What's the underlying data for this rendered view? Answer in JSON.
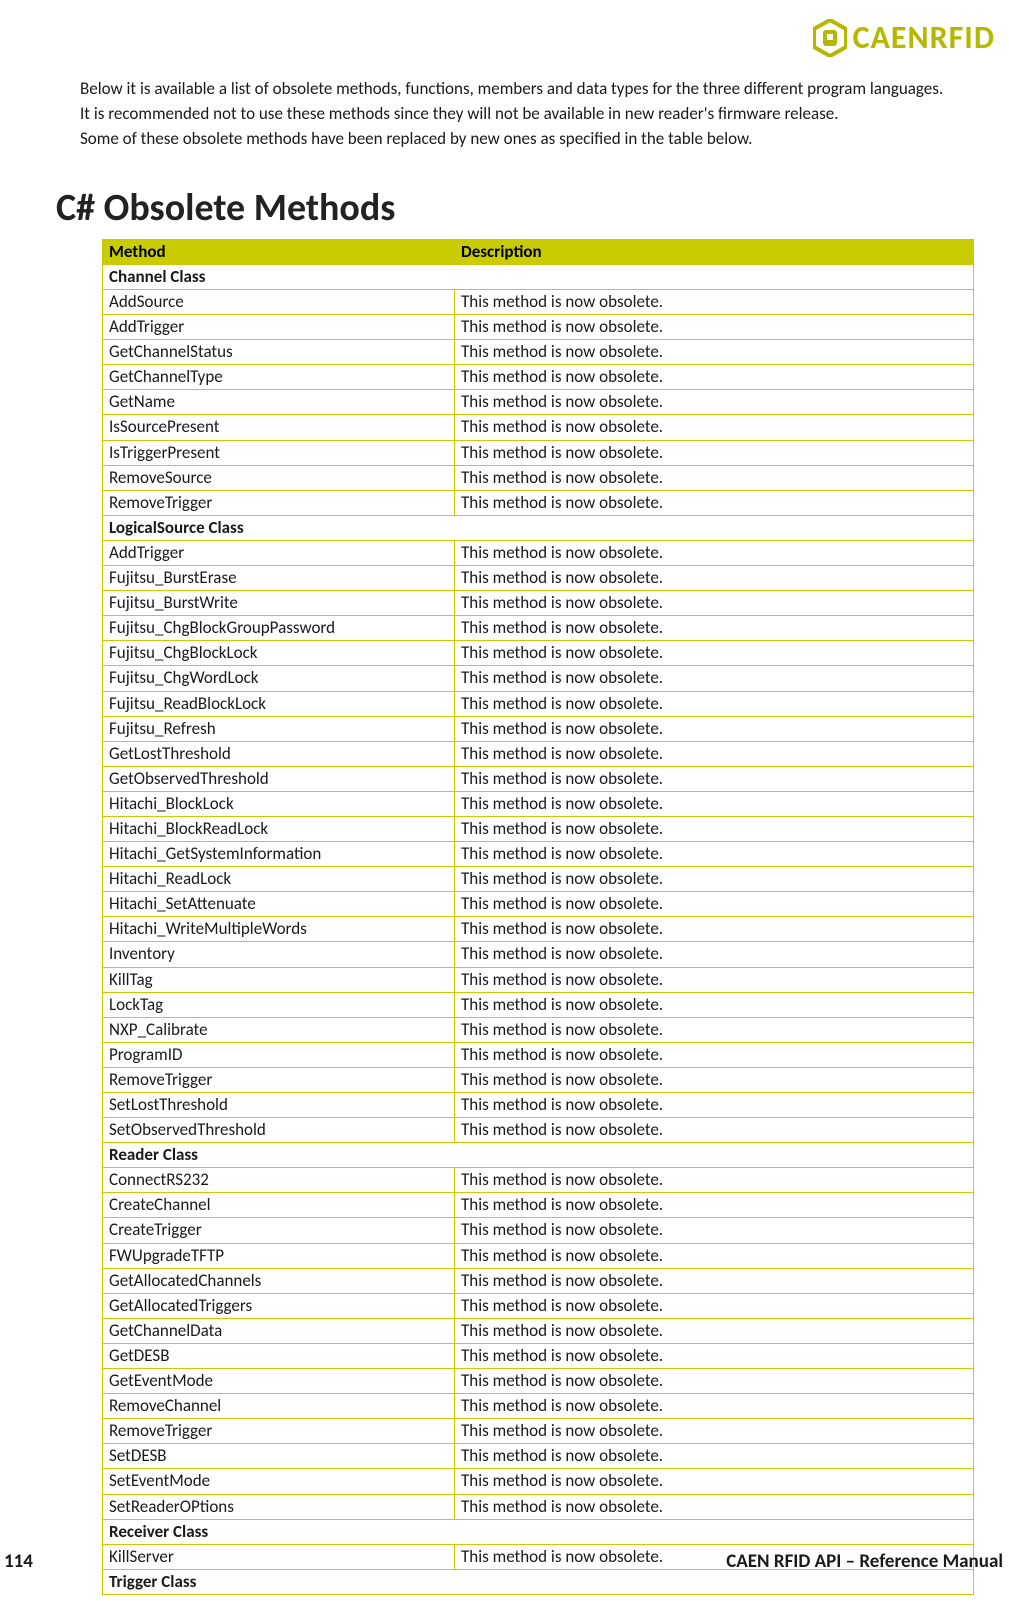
{
  "logo_text": "CAENRFID",
  "intro": {
    "p1": "Below it is available a list of obsolete methods, functions, members and data types for the three different program languages.",
    "p2": "It is recommended not to use these methods since they will not be available in new reader's firmware release.",
    "p3": "Some of these obsolete methods have been replaced by new ones as specified in the table below."
  },
  "section_title": "C# Obsolete Methods",
  "columns": {
    "method": "Method",
    "description": "Description"
  },
  "obsolete_desc": "This method is now obsolete.",
  "classes": [
    {
      "name": "Channel Class",
      "methods": [
        "AddSource",
        "AddTrigger",
        "GetChannelStatus",
        "GetChannelType",
        "GetName",
        "IsSourcePresent",
        "IsTriggerPresent",
        "RemoveSource",
        "RemoveTrigger"
      ]
    },
    {
      "name": "LogicalSource Class",
      "methods": [
        "AddTrigger",
        "Fujitsu_BurstErase",
        "Fujitsu_BurstWrite",
        "Fujitsu_ChgBlockGroupPassword",
        "Fujitsu_ChgBlockLock",
        "Fujitsu_ChgWordLock",
        "Fujitsu_ReadBlockLock",
        "Fujitsu_Refresh",
        "GetLostThreshold",
        "GetObservedThreshold",
        "Hitachi_BlockLock",
        "Hitachi_BlockReadLock",
        "Hitachi_GetSystemInformation",
        "Hitachi_ReadLock",
        "Hitachi_SetAttenuate",
        "Hitachi_WriteMultipleWords",
        "Inventory",
        "KillTag",
        "LockTag",
        "NXP_Calibrate",
        "ProgramID",
        "RemoveTrigger",
        "SetLostThreshold",
        "SetObservedThreshold"
      ]
    },
    {
      "name": "Reader Class",
      "methods": [
        "ConnectRS232",
        "CreateChannel",
        "CreateTrigger",
        "FWUpgradeTFTP",
        "GetAllocatedChannels",
        "GetAllocatedTriggers",
        "GetChannelData",
        "GetDESB",
        "GetEventMode",
        "RemoveChannel",
        "RemoveTrigger",
        "SetDESB",
        "SetEventMode",
        "SetReaderOPtions"
      ]
    },
    {
      "name": "Receiver Class",
      "methods": [
        "KillServer"
      ]
    },
    {
      "name": "Trigger Class",
      "methods": []
    }
  ],
  "footer": {
    "page_num": "114",
    "doc_title": "CAEN RFID API – Reference Manual"
  }
}
